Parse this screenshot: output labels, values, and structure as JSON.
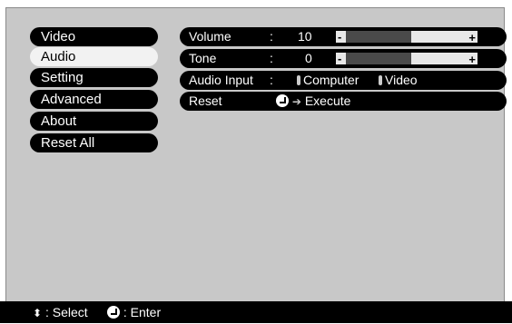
{
  "menu": {
    "items": [
      {
        "label": "Video",
        "selected": false
      },
      {
        "label": "Audio",
        "selected": true
      },
      {
        "label": "Setting",
        "selected": false
      },
      {
        "label": "Advanced",
        "selected": false
      },
      {
        "label": "About",
        "selected": false
      },
      {
        "label": "Reset All",
        "selected": false
      }
    ]
  },
  "settings": {
    "volume": {
      "label": "Volume",
      "colon": ":",
      "value": "10",
      "minus": "-",
      "plus": "+",
      "level_fraction": 0.5
    },
    "tone": {
      "label": "Tone",
      "colon": ":",
      "value": "0",
      "minus": "-",
      "plus": "+",
      "level_fraction": 0.5
    },
    "audio_input": {
      "label": "Audio Input",
      "colon": ":",
      "options": [
        "Computer",
        "Video"
      ],
      "selected": "Computer"
    },
    "reset": {
      "label": "Reset",
      "action": "Execute"
    }
  },
  "status_bar": {
    "select_text": ": Select",
    "enter_text": ": Enter"
  },
  "colors": {
    "background": "#c8c8c8",
    "menu_item": "#000000",
    "selected_item": "#f2f2f2",
    "bar_fill": "#4a4a4a"
  }
}
